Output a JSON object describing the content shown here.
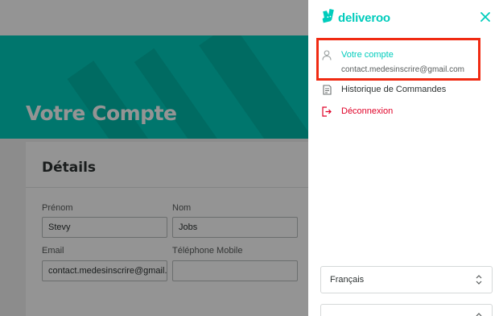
{
  "background": {
    "hero_title": "Votre Compte",
    "details": {
      "title": "Détails",
      "first_name_label": "Prénom",
      "first_name_value": "Stevy",
      "last_name_label": "Nom",
      "last_name_value": "Jobs",
      "email_label": "Email",
      "email_value": "contact.medesinscrire@gmail.co",
      "phone_label": "Téléphone Mobile",
      "phone_value": ""
    }
  },
  "drawer": {
    "logo_text": "deliveroo",
    "logo_icon": "kangaroo-logo-icon",
    "close_icon": "close-icon",
    "menu": {
      "account_label": "Votre compte",
      "account_email": "contact.medesinscrire@gmail.com",
      "orders_label": "Historique de Commandes",
      "logout_label": "Déconnexion"
    },
    "language_select": "Français",
    "second_select": ""
  },
  "colors": {
    "brand_teal": "#00ccbc",
    "logout_red": "#e00027",
    "highlight_red": "#f02a12"
  }
}
